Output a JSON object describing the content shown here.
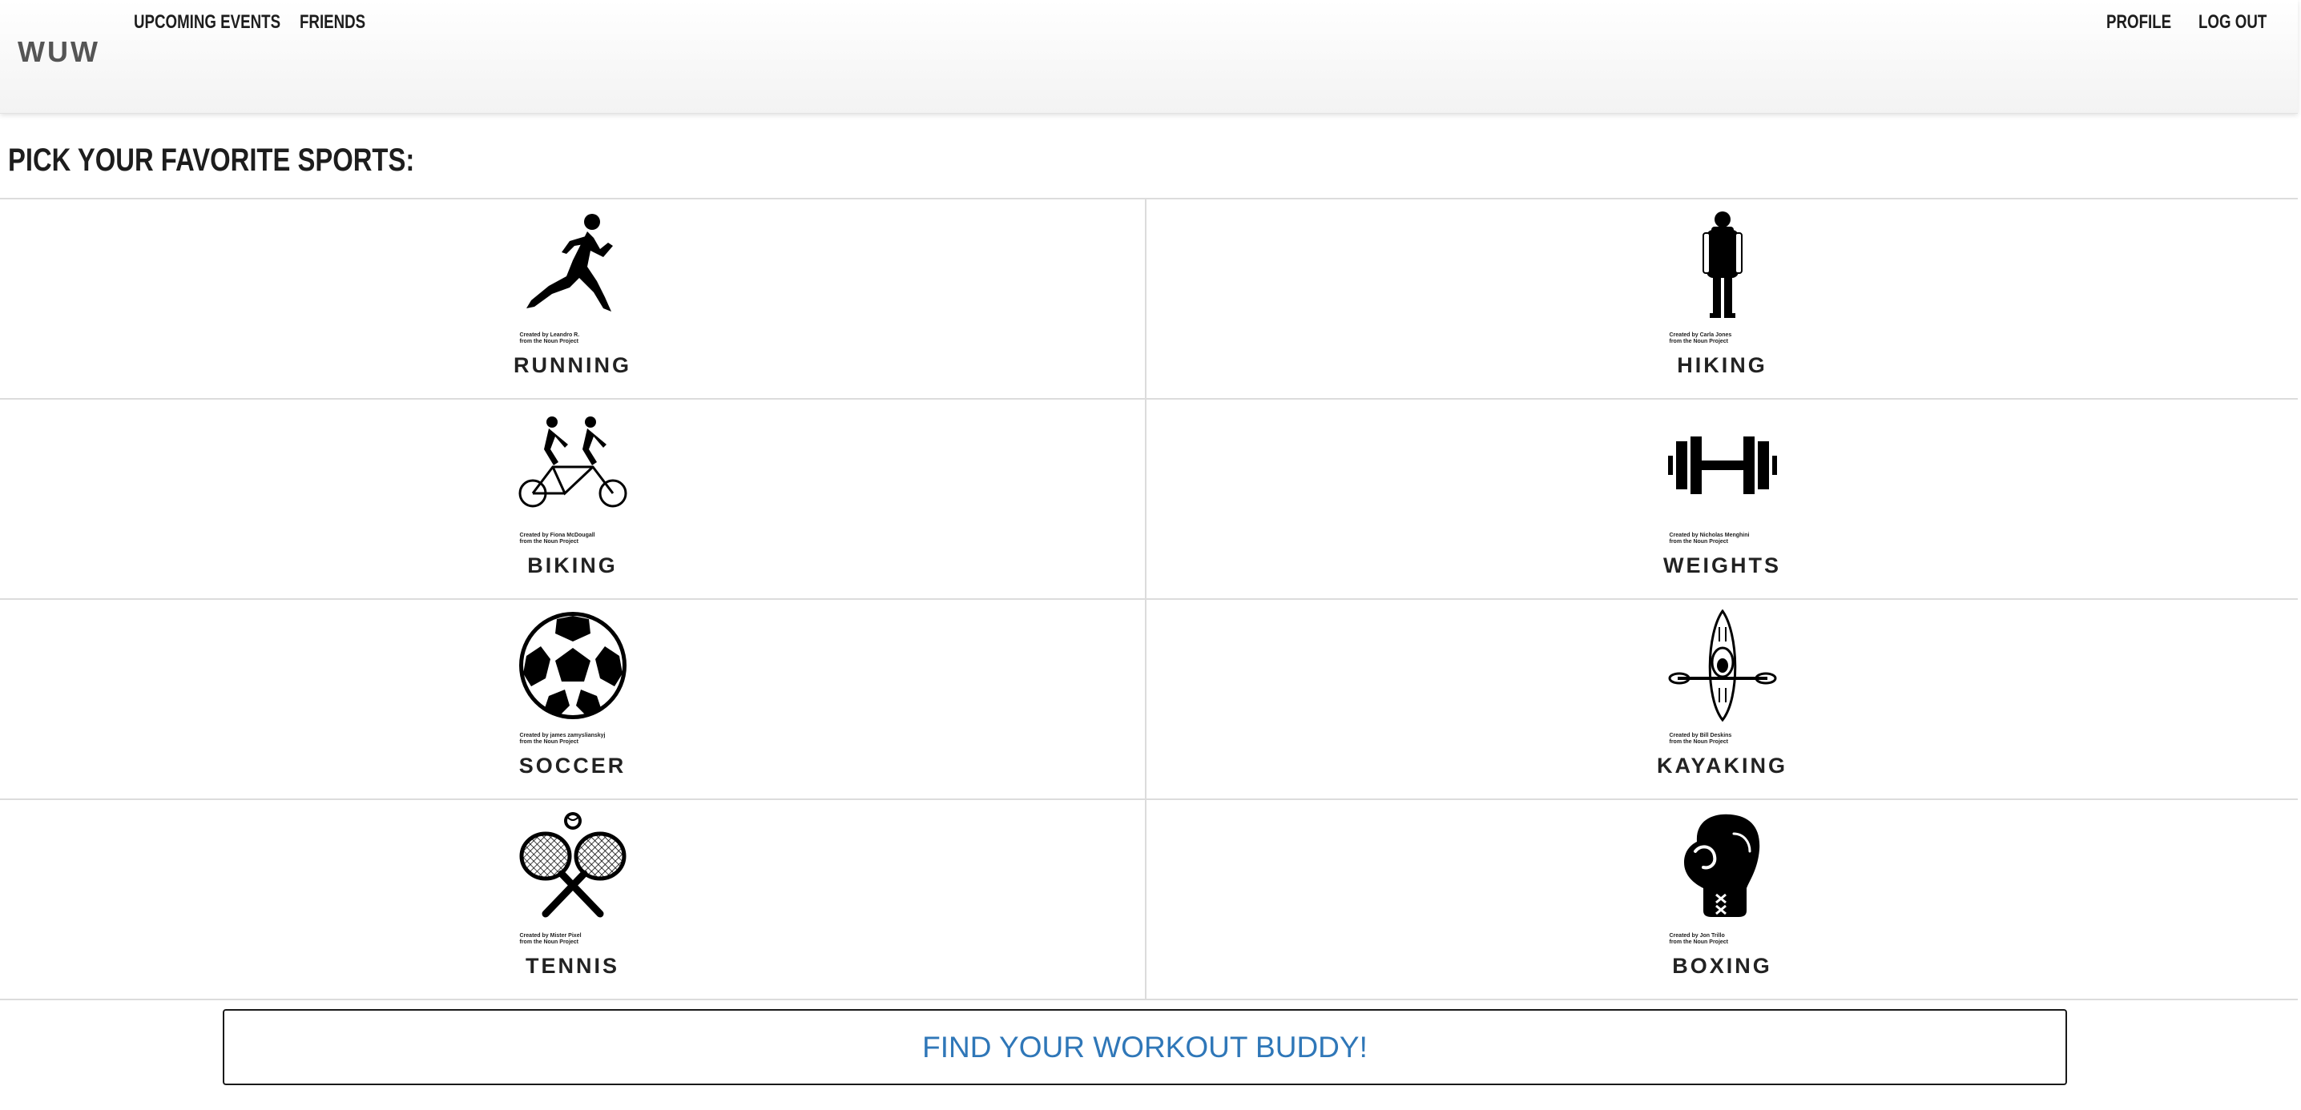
{
  "navbar": {
    "brand": "WUW",
    "left_links": [
      "UPCOMING EVENTS",
      "FRIENDS"
    ],
    "right_links": [
      "PROFILE",
      "LOG OUT"
    ]
  },
  "section": {
    "title": "PICK YOUR FAVORITE SPORTS:"
  },
  "sports": [
    {
      "label": "RUNNING",
      "icon": "runner-icon",
      "credit_line1": "Created by Leandro R.",
      "credit_line2": "from the Noun Project"
    },
    {
      "label": "HIKING",
      "icon": "hiker-icon",
      "credit_line1": "Created by Carla Jones",
      "credit_line2": "from the Noun Project"
    },
    {
      "label": "BIKING",
      "icon": "tandem-bike-icon",
      "credit_line1": "Created by Fiona McDougall",
      "credit_line2": "from the Noun Project"
    },
    {
      "label": "WEIGHTS",
      "icon": "dumbbell-icon",
      "credit_line1": "Created by Nicholas Menghini",
      "credit_line2": "from the Noun Project"
    },
    {
      "label": "SOCCER",
      "icon": "soccer-ball-icon",
      "credit_line1": "Created by james zamyslianskyj",
      "credit_line2": "from the Noun Project"
    },
    {
      "label": "KAYAKING",
      "icon": "kayak-icon",
      "credit_line1": "Created by Bill Deskins",
      "credit_line2": "from the Noun Project"
    },
    {
      "label": "TENNIS",
      "icon": "tennis-rackets-icon",
      "credit_line1": "Created by Mister Pixel",
      "credit_line2": "from the Noun Project"
    },
    {
      "label": "BOXING",
      "icon": "boxing-glove-icon",
      "credit_line1": "Created by Jon Trillo",
      "credit_line2": "from the Noun Project"
    }
  ],
  "cta": {
    "label": "FIND YOUR WORKOUT BUDDY!"
  },
  "colors": {
    "cta_text": "#2f77b8",
    "grid_line": "#dcdcdc"
  }
}
